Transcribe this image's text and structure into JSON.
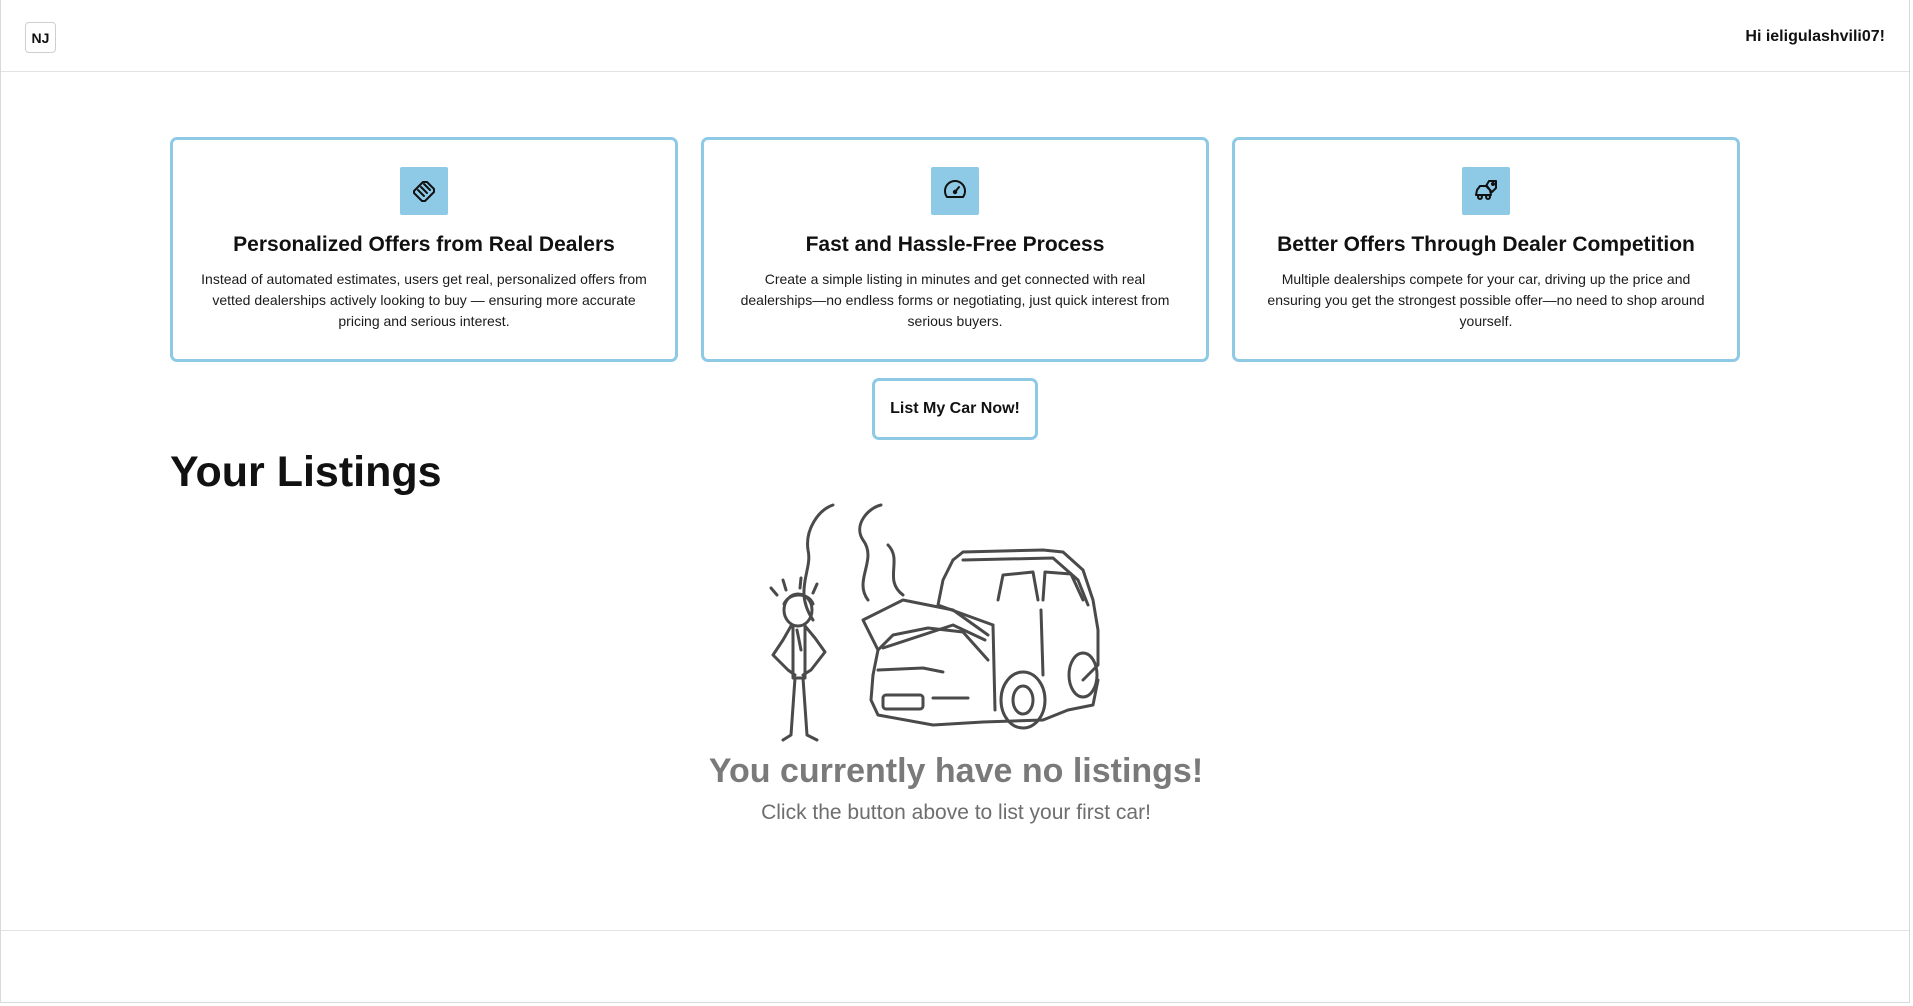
{
  "header": {
    "logo_text": "NJ",
    "greeting": "Hi ieligulashvili07!"
  },
  "features": [
    {
      "icon": "handshake-icon",
      "title": "Personalized Offers from Real Dealers",
      "description": "Instead of automated estimates, users get real, personalized offers from vetted dealerships actively looking to buy — ensuring more accurate pricing and serious interest."
    },
    {
      "icon": "speedometer-icon",
      "title": "Fast and Hassle-Free Process",
      "description": "Create a simple listing in minutes and get connected with real dealerships—no endless forms or negotiating, just quick interest from serious buyers."
    },
    {
      "icon": "car-tag-icon",
      "title": "Better Offers Through Dealer Competition",
      "description": "Multiple dealerships compete for your car, driving up the price and ensuring you get the strongest possible offer—no need to shop around yourself."
    }
  ],
  "cta": {
    "label": "List My Car Now!"
  },
  "listings": {
    "title": "Your Listings",
    "empty_title": "You currently have no listings!",
    "empty_subtitle": "Click the button above to list your first car!"
  },
  "colors": {
    "accent": "#8ec9e6",
    "muted_text": "#7a7a7a"
  }
}
